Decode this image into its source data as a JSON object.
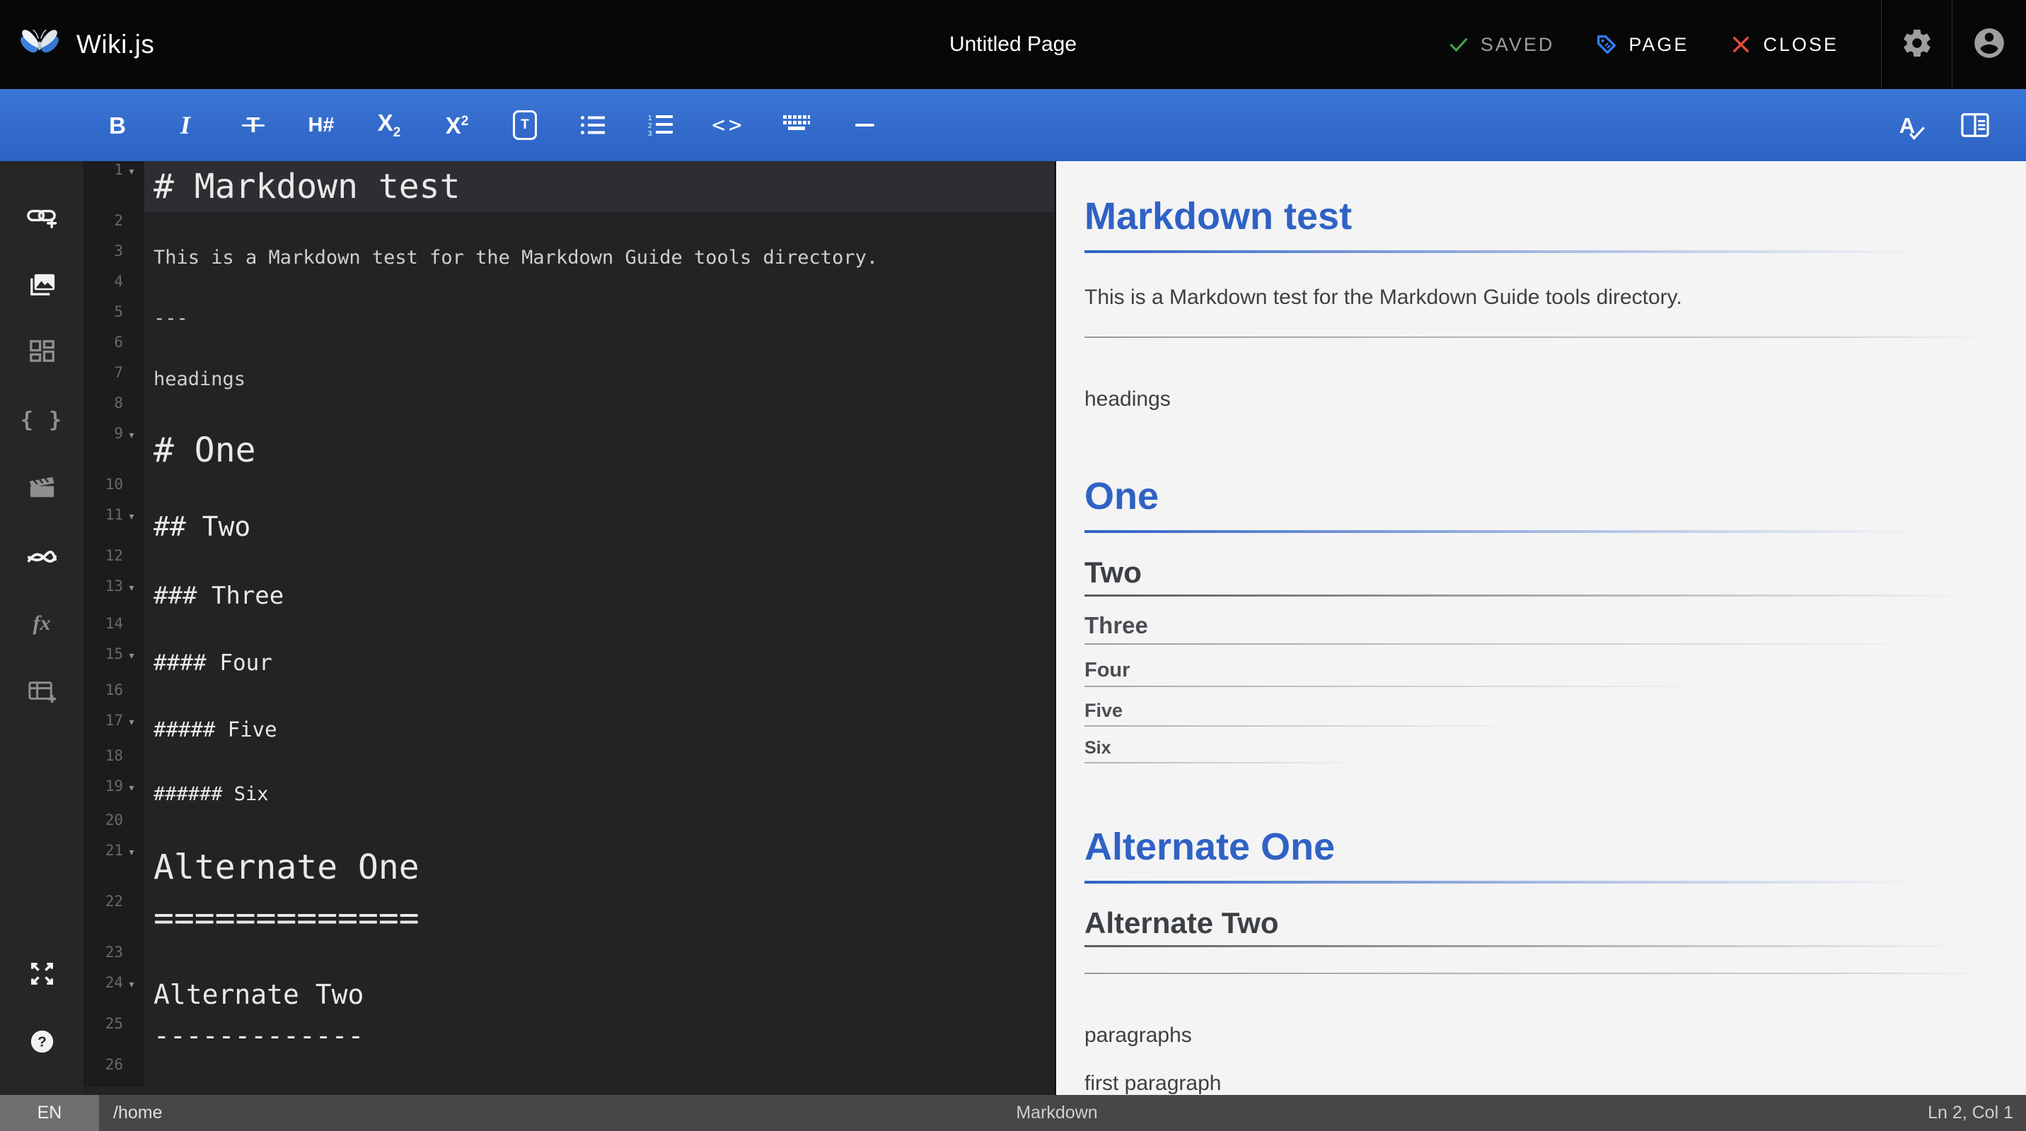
{
  "colors": {
    "toolbar_blue_top": "#3b76d4",
    "toolbar_blue_bottom": "#2c62c4",
    "heading_blue": "#2f62c4",
    "saved_green": "#43a047",
    "page_tag_blue": "#2e7cf6",
    "close_red": "#e8493a",
    "editor_bg": "#222325",
    "preview_bg": "#f4f4f5"
  },
  "header": {
    "app_title": "Wiki.js",
    "logo_icon": "butterfly-logo-icon",
    "page_title": "Untitled Page",
    "actions": [
      {
        "id": "saved",
        "icon": "check-icon",
        "label": "SAVED"
      },
      {
        "id": "page",
        "icon": "tag-icon",
        "label": "PAGE"
      },
      {
        "id": "close",
        "icon": "close-x-icon",
        "label": "CLOSE"
      }
    ],
    "settings_icon": "gear-icon",
    "account_icon": "account-circle-icon"
  },
  "toolbar": {
    "left": [
      {
        "icon": "bold-icon",
        "label": "B"
      },
      {
        "icon": "italic-icon",
        "label": "I"
      },
      {
        "icon": "strikethrough-icon",
        "label": "T"
      },
      {
        "icon": "heading-icon",
        "label": "H#"
      },
      {
        "icon": "subscript-icon",
        "label": "X",
        "sub": "2"
      },
      {
        "icon": "superscript-icon",
        "label": "X",
        "sup": "2"
      },
      {
        "icon": "textbox-icon",
        "label": "T"
      },
      {
        "icon": "bullet-list-icon"
      },
      {
        "icon": "numbered-list-icon",
        "numbers": [
          "1",
          "2",
          "3"
        ]
      },
      {
        "icon": "inline-code-icon",
        "label": "<>"
      },
      {
        "icon": "keyboard-icon"
      },
      {
        "icon": "horizontal-rule-icon"
      }
    ],
    "right": [
      {
        "icon": "spellcheck-icon",
        "label": "A"
      },
      {
        "icon": "split-view-icon"
      }
    ]
  },
  "sidebar": {
    "items": [
      {
        "icon": "insert-link-icon",
        "bright": true
      },
      {
        "icon": "insert-image-icon",
        "bright": true
      },
      {
        "icon": "insert-block-icon",
        "bright": false
      },
      {
        "icon": "code-braces-icon",
        "bright": false,
        "label": "{ }"
      },
      {
        "icon": "insert-video-icon",
        "bright": false
      },
      {
        "icon": "insert-diagram-icon",
        "bright": true
      },
      {
        "icon": "math-function-icon",
        "bright": false,
        "label": "fx"
      },
      {
        "icon": "insert-table-icon",
        "bright": false
      }
    ],
    "bottom_items": [
      {
        "icon": "fullscreen-icon",
        "bright": true
      },
      {
        "icon": "help-icon",
        "bright": true
      }
    ]
  },
  "editor": {
    "lines": [
      {
        "num": 1,
        "text": "# Markdown test",
        "style": "h1",
        "fold": true,
        "active": true
      },
      {
        "num": 2,
        "text": "",
        "style": "body"
      },
      {
        "num": 3,
        "text": "This is a Markdown test for the Markdown Guide tools directory.",
        "style": "body"
      },
      {
        "num": 4,
        "text": "",
        "style": "body"
      },
      {
        "num": 5,
        "text": "---",
        "style": "body"
      },
      {
        "num": 6,
        "text": "",
        "style": "body"
      },
      {
        "num": 7,
        "text": "headings",
        "style": "body"
      },
      {
        "num": 8,
        "text": "",
        "style": "body"
      },
      {
        "num": 9,
        "text": "# One",
        "style": "h1",
        "fold": true
      },
      {
        "num": 10,
        "text": "",
        "style": "body"
      },
      {
        "num": 11,
        "text": "## Two",
        "style": "h2",
        "fold": true
      },
      {
        "num": 12,
        "text": "",
        "style": "body"
      },
      {
        "num": 13,
        "text": "### Three",
        "style": "h3",
        "fold": true
      },
      {
        "num": 14,
        "text": "",
        "style": "body"
      },
      {
        "num": 15,
        "text": "#### Four",
        "style": "h4",
        "fold": true
      },
      {
        "num": 16,
        "text": "",
        "style": "body"
      },
      {
        "num": 17,
        "text": "##### Five",
        "style": "h5",
        "fold": true
      },
      {
        "num": 18,
        "text": "",
        "style": "body"
      },
      {
        "num": 19,
        "text": "###### Six",
        "style": "h6",
        "fold": true
      },
      {
        "num": 20,
        "text": "",
        "style": "body"
      },
      {
        "num": 21,
        "text": "Alternate One",
        "style": "h1",
        "fold": true
      },
      {
        "num": 22,
        "text": "=============",
        "style": "h1"
      },
      {
        "num": 23,
        "text": "",
        "style": "body"
      },
      {
        "num": 24,
        "text": "Alternate Two",
        "style": "h2",
        "fold": true
      },
      {
        "num": 25,
        "text": "-------------",
        "style": "h2"
      },
      {
        "num": 26,
        "text": "",
        "style": "body"
      }
    ]
  },
  "preview": {
    "blocks": [
      {
        "t": "h1",
        "text": "Markdown test"
      },
      {
        "t": "p",
        "text": "This is a Markdown test for the Markdown Guide tools directory."
      },
      {
        "t": "hr"
      },
      {
        "t": "p",
        "text": "headings"
      },
      {
        "t": "h1",
        "text": "One"
      },
      {
        "t": "h2",
        "text": "Two"
      },
      {
        "t": "h3",
        "text": "Three"
      },
      {
        "t": "h4",
        "text": "Four"
      },
      {
        "t": "h5",
        "text": "Five"
      },
      {
        "t": "h6",
        "text": "Six"
      },
      {
        "t": "h1",
        "text": "Alternate One"
      },
      {
        "t": "h2",
        "text": "Alternate Two"
      },
      {
        "t": "hr"
      },
      {
        "t": "p",
        "text": "paragraphs"
      },
      {
        "t": "p",
        "text": "first paragraph"
      }
    ]
  },
  "statusbar": {
    "locale": "EN",
    "path": "/home",
    "mode": "Markdown",
    "cursor": "Ln 2, Col 1"
  }
}
